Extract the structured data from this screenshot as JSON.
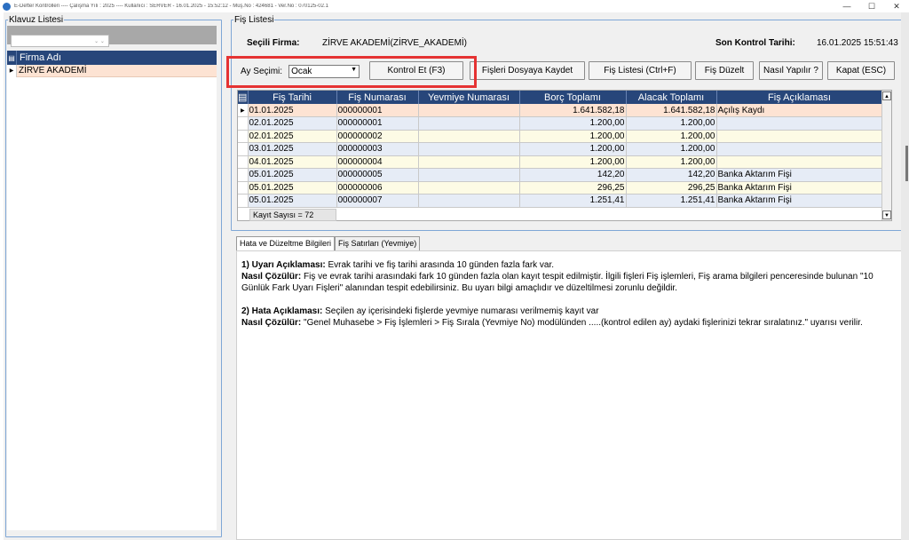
{
  "window": {
    "title": "E-Defter Kontrolleri ---- Çalışma Yılı : 2025 ---- Kullanıcı : SERVER - 16.01.2025 - 15:52:12 - Müş.No : 424681 - Ver.No : 070125-02.1",
    "buttons": {
      "minimize": "—",
      "maximize": "☐",
      "close": "✕"
    }
  },
  "klavuz": {
    "title": "Klavuz Listesi",
    "combo_value": "",
    "header": "Firma Adı",
    "rows": [
      "ZİRVE AKADEMİ"
    ]
  },
  "fis_listesi": {
    "title": "Fiş Listesi",
    "secili_firma_label": "Seçili Firma:",
    "secili_firma_value": "ZİRVE AKADEMİ(ZİRVE_AKADEMİ)",
    "son_kontrol_label": "Son Kontrol Tarihi:",
    "son_kontrol_value": "16.01.2025 15:51:43",
    "ay_secimi_label": "Ay Seçimi:",
    "ay_secimi_value": "Ocak",
    "buttons": {
      "kontrol_et": "Kontrol Et (F3)",
      "dosyaya_kaydet": "Fişleri Dosyaya Kaydet",
      "fis_listesi": "Fiş Listesi (Ctrl+F)",
      "fis_duzelt": "Fiş Düzelt",
      "nasil_yapilir": "Nasıl Yapılır ?",
      "kapat": "Kapat (ESC)"
    },
    "columns": [
      "Fiş Tarihi",
      "Fiş Numarası",
      "Yevmiye Numarası",
      "Borç Toplamı",
      "Alacak Toplamı",
      "Fiş Açıklaması"
    ],
    "rows": [
      [
        "01.01.2025",
        "000000001",
        "",
        "1.641.582,18",
        "1.641.582,18",
        "Açılış Kaydı"
      ],
      [
        "02.01.2025",
        "000000001",
        "",
        "1.200,00",
        "1.200,00",
        ""
      ],
      [
        "02.01.2025",
        "000000002",
        "",
        "1.200,00",
        "1.200,00",
        ""
      ],
      [
        "03.01.2025",
        "000000003",
        "",
        "1.200,00",
        "1.200,00",
        ""
      ],
      [
        "04.01.2025",
        "000000004",
        "",
        "1.200,00",
        "1.200,00",
        ""
      ],
      [
        "05.01.2025",
        "000000005",
        "",
        "142,20",
        "142,20",
        "Banka Aktarım Fişi"
      ],
      [
        "05.01.2025",
        "000000006",
        "",
        "296,25",
        "296,25",
        "Banka Aktarım Fişi"
      ],
      [
        "05.01.2025",
        "000000007",
        "",
        "1.251,41",
        "1.251,41",
        "Banka Aktarım Fişi"
      ]
    ],
    "kayit_sayisi": "Kayıt Sayısı = 72"
  },
  "tabs": {
    "items": [
      "Hata ve Düzeltme Bilgileri",
      "Fiş Satırları (Yevmiye)"
    ],
    "active_index": 0
  },
  "bilgi": {
    "u1_title": "1) Uyarı Açıklaması:",
    "u1_text": " Evrak tarihi ve fiş tarihi arasında 10 günden fazla fark var.",
    "u1_cozum_title": "Nasıl Çözülür:",
    "u1_cozum_text": " Fiş ve evrak tarihi arasındaki fark 10 günden fazla olan kayıt tespit edilmiştir. İlgili fişleri Fiş işlemleri, Fiş arama bilgileri penceresinde bulunan \"10 Günlük Fark Uyarı Fişleri\" alanından tespit edebilirsiniz. Bu uyarı bilgi amaçlıdır ve düzeltilmesi zorunlu değildir.",
    "h2_title": "2) Hata Açıklaması:",
    "h2_text": " Seçilen ay içerisindeki fişlerde yevmiye numarası verilmemiş kayıt var",
    "h2_cozum_title": "Nasıl Çözülür:",
    "h2_cozum_text": " \"Genel Muhasebe > Fiş İşlemleri > Fiş Sırala (Yevmiye No) modülünden .....(kontrol edilen ay) aydaki fişlerinizi tekrar sıralatınız.\" uyarısı verilir."
  },
  "colors": {
    "header_bg": "#27467a",
    "selected_row": "#fde3d3",
    "row_yellow": "#fdfbe5",
    "row_blue": "#e6ecf6",
    "highlight": "#e53333"
  }
}
